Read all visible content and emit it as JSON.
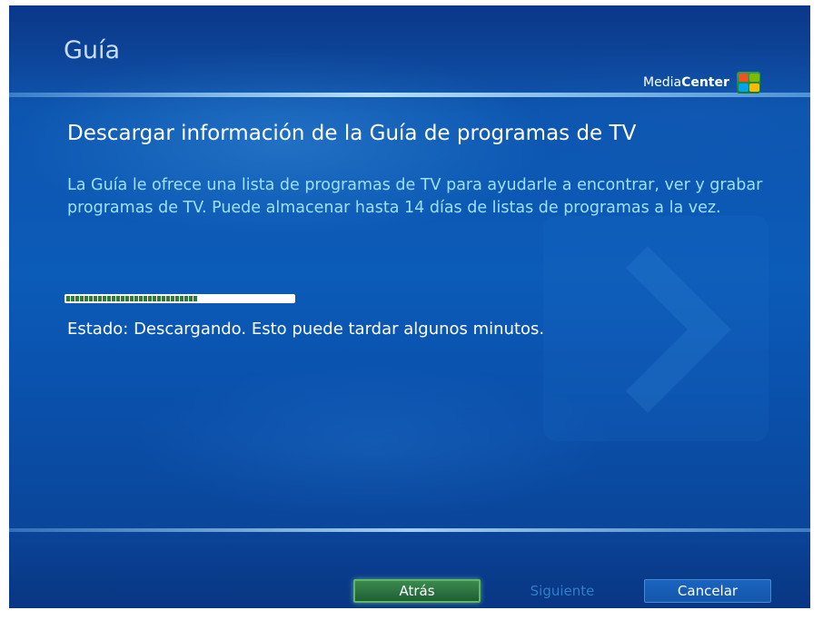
{
  "header": {
    "title": "Guía",
    "brand": {
      "light": "Media",
      "bold": "Center"
    },
    "brand_icon": "windows-flag-icon"
  },
  "main": {
    "heading": "Descargar información de la Guía de programas de TV",
    "description": "La Guía le ofrece una lista de programas de TV para ayudarle a encontrar, ver y grabar programas de TV. Puede almacenar hasta 14 días de listas de programas a la vez.",
    "progress": {
      "fraction": 0.58
    },
    "status": "Estado: Descargando. Esto puede tardar algunos minutos."
  },
  "footer": {
    "back_label": "Atrás",
    "next_label": "Siguiente",
    "cancel_label": "Cancelar"
  },
  "colors": {
    "background": "#0b5bb8",
    "description_text": "#9ee0ff",
    "progress_fill": "#2f7a3a",
    "focused_button": "#3b8a4e"
  }
}
